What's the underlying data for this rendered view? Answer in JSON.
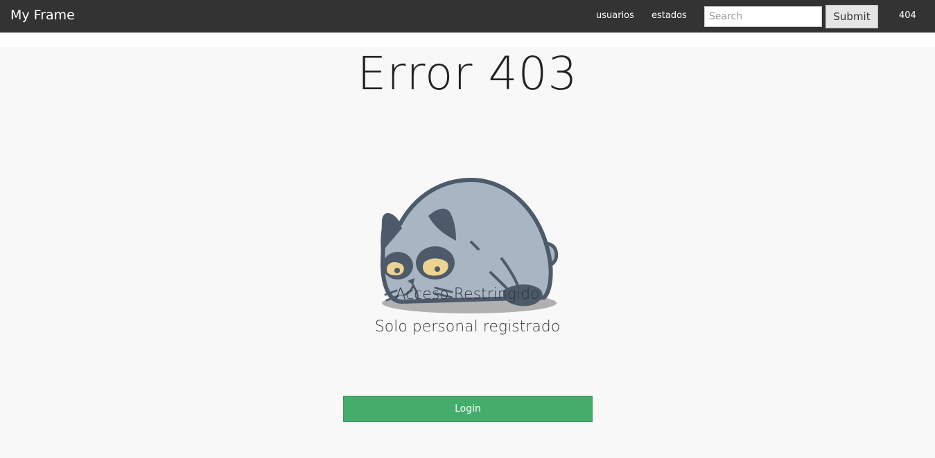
{
  "navbar": {
    "brand": "My Frame",
    "links": [
      "usuarios",
      "estados",
      "404"
    ],
    "search": {
      "placeholder": "Search",
      "value": ""
    },
    "submit_label": "Submit",
    "background": "#333333"
  },
  "main": {
    "title": "Error 403",
    "illustration": "grumpy-cat-icon",
    "message_1": "Acceso Restringido",
    "message_2": "Solo personal registrado",
    "login_label": "Login",
    "login_color": "#44ad6b",
    "background": "#f8f8f8"
  }
}
